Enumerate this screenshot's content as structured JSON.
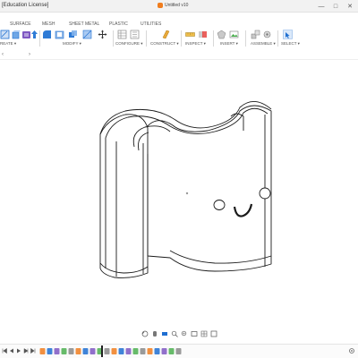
{
  "titlebar": {
    "app_title": "[Education License]",
    "doc_title": "Untitled v10",
    "minimize_glyph": "—",
    "maximize_glyph": "□",
    "close_glyph": "✕"
  },
  "ribbon": {
    "tabs": [
      "SURFACE",
      "MESH",
      "SHEET METAL",
      "PLASTIC",
      "UTILITIES"
    ],
    "groups": [
      "REATE ▾",
      "MODIFY ▾",
      "CONFIGURE ▾",
      "CONSTRUCT ▾",
      "INSPECT ▾",
      "INSERT ▾",
      "ASSEMBLE ▾",
      "SELECT ▾"
    ],
    "icons": [
      "sketch-icon",
      "box-icon",
      "extrude-icon",
      "press-pull-icon",
      "fillet-icon",
      "shell-icon",
      "combine-icon",
      "move-icon",
      "configure-table-icon",
      "configure-rule-icon",
      "offset-plane-icon",
      "measure-icon",
      "interference-icon",
      "section-analysis-icon",
      "insert-mesh-icon",
      "insert-canvas-icon",
      "joint-icon",
      "as-built-joint-icon",
      "select-icon"
    ]
  },
  "colors": {
    "accent": "#1f6fd1",
    "orange": "#f07d1e",
    "green": "#4caf50",
    "purple": "#7e57c2",
    "red": "#e53935",
    "model_stroke": "#1a1a1a",
    "model_fill": "#ffffff"
  },
  "nav_bar": {
    "icons": [
      "orbit-icon",
      "pan-icon",
      "look-at-icon",
      "zoom-icon",
      "fit-icon",
      "display-settings-icon",
      "grid-icon",
      "viewports-icon"
    ]
  },
  "timeline": {
    "controls": [
      "go-to-start-icon",
      "previous-step-icon",
      "play-icon",
      "next-step-icon",
      "go-to-end-icon"
    ],
    "feature_count": 20
  }
}
